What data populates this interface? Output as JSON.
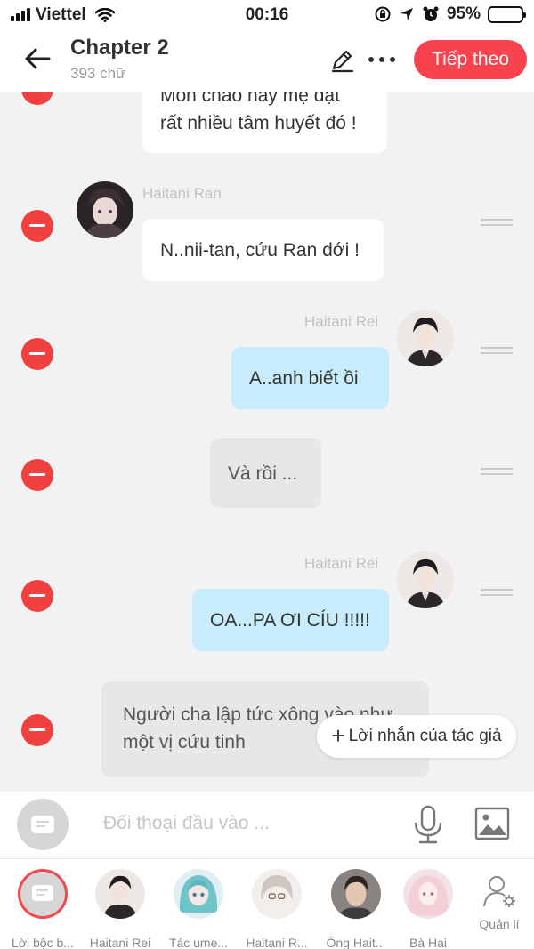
{
  "status_bar": {
    "carrier": "Viettel",
    "time": "00:16",
    "battery": "95%",
    "battery_level": 0.95
  },
  "header": {
    "title": "Chapter 2",
    "word_count": "393 chữ",
    "next_label": "Tiếp theo"
  },
  "messages": [
    {
      "type": "partial",
      "text_lines": [
        "Món cháo này mẹ đặt",
        "rất nhiều tâm huyết đó !"
      ]
    },
    {
      "speaker": "Haitani Ran",
      "side": "left",
      "text": "N..nii-tan, cứu Ran dới !"
    },
    {
      "speaker": "Haitani Rei",
      "side": "right",
      "text": "A..anh biết ồi"
    },
    {
      "side": "center",
      "text": "Và rồi ..."
    },
    {
      "speaker": "Haitani Rei",
      "side": "right",
      "text": "OA...PA ƠI CÍU !!!!!"
    },
    {
      "side": "narration",
      "text_lines": [
        "Người cha lập tức xông vào như",
        "một vị cứu tinh"
      ]
    }
  ],
  "author_note_label": "Lời nhắn của tác giả",
  "input": {
    "placeholder": "Đối thoại đầu vào ..."
  },
  "characters": [
    {
      "label": "Lời bộc b..."
    },
    {
      "label": "Haitani Rei"
    },
    {
      "label": "Tác ume..."
    },
    {
      "label": "Haitani R..."
    },
    {
      "label": "Ông Hait..."
    },
    {
      "label": "Bà Hai"
    }
  ],
  "manage_label": "Quản lí",
  "colors": {
    "accent": "#f8434f",
    "delete": "#f04040",
    "bubble_blue": "#c8ecfb",
    "bubble_grey": "#e7e7e8"
  }
}
